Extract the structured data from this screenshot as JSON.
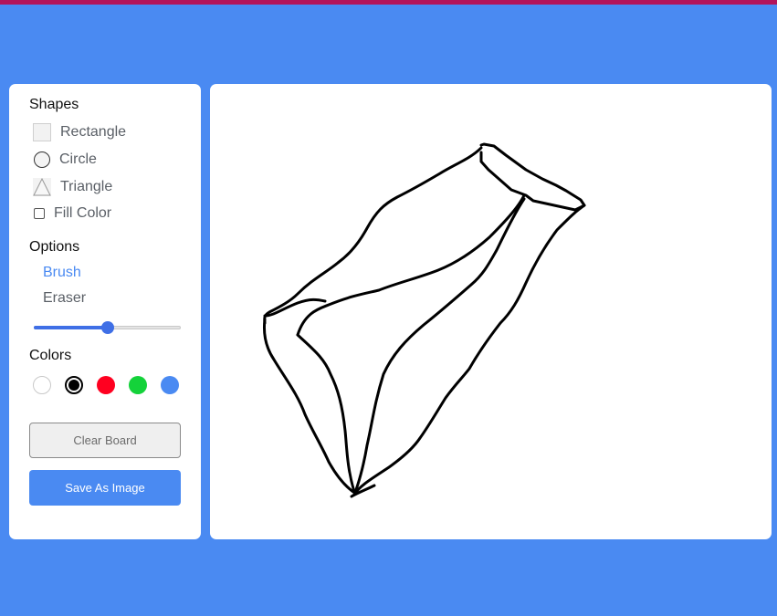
{
  "shapes": {
    "title": "Shapes",
    "items": [
      {
        "label": "Rectangle",
        "icon": "rectangle-icon"
      },
      {
        "label": "Circle",
        "icon": "circle-icon"
      },
      {
        "label": "Triangle",
        "icon": "triangle-icon"
      }
    ],
    "fill_color_label": "Fill Color",
    "fill_color_checked": false
  },
  "options": {
    "title": "Options",
    "brush_label": "Brush",
    "eraser_label": "Eraser",
    "selected": "Brush",
    "size_value_fraction": 0.5
  },
  "colors": {
    "title": "Colors",
    "swatches": [
      "#ffffff",
      "#000000",
      "#ff0020",
      "#14d23a",
      "#4a8af2"
    ],
    "selected": "#000000"
  },
  "buttons": {
    "clear_label": "Clear Board",
    "save_label": "Save As Image"
  },
  "theme": {
    "background": "#4a8af2",
    "top_strip": "#b3145a",
    "accent": "#4a8af2"
  }
}
